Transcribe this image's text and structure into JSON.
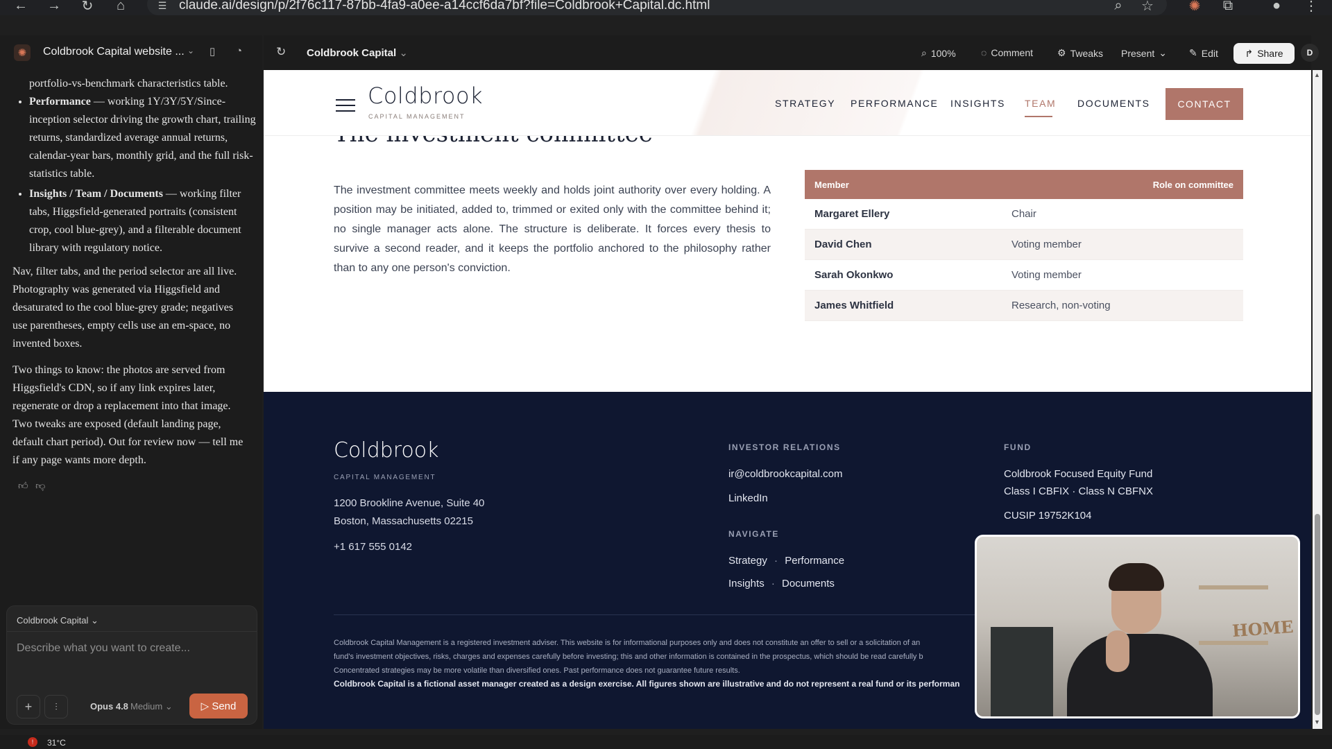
{
  "browser": {
    "url": "claude.ai/design/p/2f76c117-87bb-4fa9-a0ee-a14ccf6da7bf?file=Coldbrook+Capital.dc.html",
    "accent_icon_color": "#d97757"
  },
  "left_panel": {
    "project_title": "Coldbrook Capital website ...",
    "chat": {
      "fragment_top": "portfolio-vs-benchmark characteristics table.",
      "bullets": [
        {
          "bold": "Performance",
          "text": " — working 1Y/3Y/5Y/Since-inception selector driving the growth chart, trailing returns, standardized average annual returns, calendar-year bars, monthly grid, and the full risk-statistics table."
        },
        {
          "bold": "Insights / Team / Documents",
          "text": " — working filter tabs, Higgsfield-generated portraits (consistent crop, cool blue-grey), and a filterable document library with regulatory notice."
        }
      ],
      "para1": "Nav, filter tabs, and the period selector are all live. Photography was generated via Higgsfield and desaturated to the cool blue-grey grade; negatives use parentheses, empty cells use an em-space, no invented boxes.",
      "para2": "Two things to know: the photos are served from Higgsfield's CDN, so if any link expires later, regenerate or drop a replacement into that image. Two tweaks are exposed (default landing page, default chart period). Out for review now — tell me if any page wants more depth."
    },
    "composer": {
      "project": "Coldbrook Capital",
      "placeholder": "Describe what you want to create...",
      "model": "Opus 4.8",
      "effort": "Medium",
      "send": "Send"
    }
  },
  "toolbar": {
    "doc_title": "Coldbrook Capital",
    "zoom": "100%",
    "comment": "Comment",
    "tweaks": "Tweaks",
    "present": "Present",
    "edit": "Edit",
    "share": "Share",
    "avatar": "D"
  },
  "site": {
    "brand": "Coldbrook",
    "brand_sub": "CAPITAL MANAGEMENT",
    "nav": [
      "STRATEGY",
      "PERFORMANCE",
      "INSIGHTS",
      "TEAM",
      "DOCUMENTS"
    ],
    "contact": "CONTACT",
    "accent_color": "#b0766a",
    "navy_color": "#0f1730",
    "section_heading": "The investment committee",
    "section_body": "The investment committee meets weekly and holds joint authority over every holding. A position may be initiated, added to, trimmed or exited only with the committee behind it; no single manager acts alone. The structure is deliberate. It forces every thesis to survive a second reader, and it keeps the portfolio anchored to the philosophy rather than to any one person's conviction.",
    "table": {
      "headers": [
        "Member",
        "Role on committee"
      ],
      "rows": [
        [
          "Margaret Ellery",
          "Chair"
        ],
        [
          "David Chen",
          "Voting member"
        ],
        [
          "Sarah Okonkwo",
          "Voting member"
        ],
        [
          "James Whitfield",
          "Research, non-voting"
        ]
      ]
    },
    "footer": {
      "brand": "Coldbrook",
      "brand_sub": "CAPITAL MANAGEMENT",
      "address_line1": "1200 Brookline Avenue, Suite 40",
      "address_line2": "Boston, Massachusetts 02215",
      "phone": "+1 617 555 0142",
      "investor_relations_head": "INVESTOR RELATIONS",
      "email": "ir@coldbrookcapital.com",
      "linkedin": "LinkedIn",
      "navigate_head": "NAVIGATE",
      "nav_row1": [
        "Strategy",
        "Performance"
      ],
      "nav_row2": [
        "Insights",
        "Documents"
      ],
      "fund_head": "FUND",
      "fund_name": "Coldbrook Focused Equity Fund",
      "fund_classes": "Class I  CBFIX  ·  Class N  CBFNX",
      "cusip": "CUSIP 19752K104",
      "dot": "·",
      "disclaimer_lines": [
        "Coldbrook Capital Management is a registered investment adviser. This website is for informational purposes only and does not constitute an offer to sell or a solicitation of an",
        "fund's investment objectives, risks, charges and expenses carefully before investing; this and other information is contained in the prospectus, which should be read carefully b",
        "Concentrated strategies may be more volatile than diversified ones. Past performance does not guarantee future results."
      ],
      "fictional_notice": "Coldbrook Capital is a fictional asset manager created as a design exercise. All figures shown are illustrative and do not represent a real fund or its performan"
    }
  },
  "webcam": {
    "sign": "HOME"
  },
  "taskbar": {
    "temp": "31°C"
  }
}
